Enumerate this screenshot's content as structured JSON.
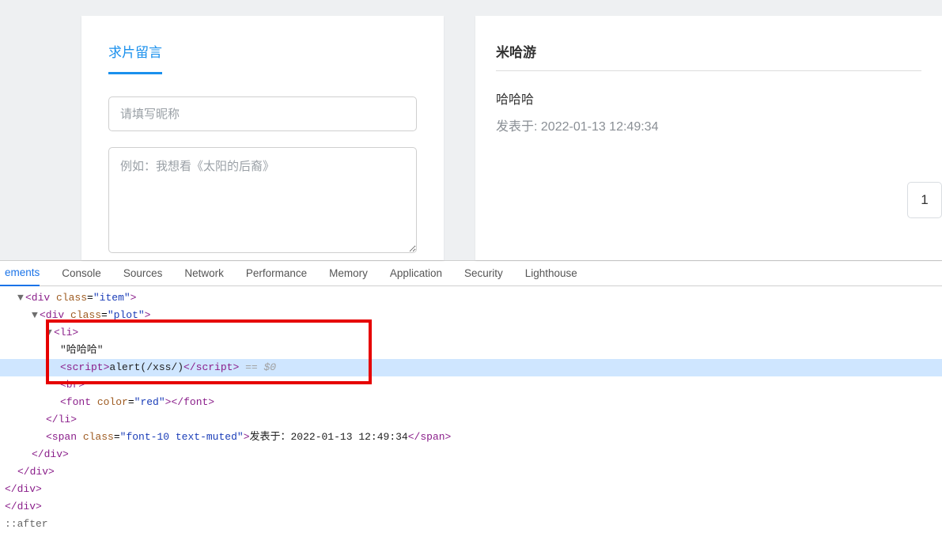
{
  "form": {
    "tab_title": "求片留言",
    "nickname_placeholder": "请填写昵称",
    "message_placeholder": "例如：我想看《太阳的后裔》"
  },
  "comment": {
    "user_name": "米哈游",
    "content": "哈哈哈",
    "posted_label": "发表于: 2022-01-13 12:49:34"
  },
  "pager": {
    "current": "1"
  },
  "devtools": {
    "tabs": [
      "ements",
      "Console",
      "Sources",
      "Network",
      "Performance",
      "Memory",
      "Application",
      "Security",
      "Lighthouse"
    ],
    "active_tab_index": 0,
    "dom": {
      "line1_open_div_item": "<div class=\"item\">",
      "line2_open_div_plot": "<div class=\"plot\">",
      "line3_open_li": "<li>",
      "line4_text": "\"哈哈哈\"",
      "line5_script_open": "<script>",
      "line5_script_body": "alert(/xss/)",
      "line5_script_close": "</",
      "line5_script_close2": "script>",
      "line5_eq": " == ",
      "line5_dollar": "$0",
      "line6_br": "<br>",
      "line7_font_open": "<font color=\"red\">",
      "line7_font_close": "</font>",
      "line8_close_li": "</li>",
      "line9_span_open": "<span class=\"font-10 text-muted\">",
      "line9_span_text": "发表于：2022-01-13 12:49:34",
      "line9_span_close": "</span>",
      "line10": "</div>",
      "line11": "</div>",
      "line12": "</div>",
      "line13": "</div>",
      "line14_after": "::after"
    }
  }
}
